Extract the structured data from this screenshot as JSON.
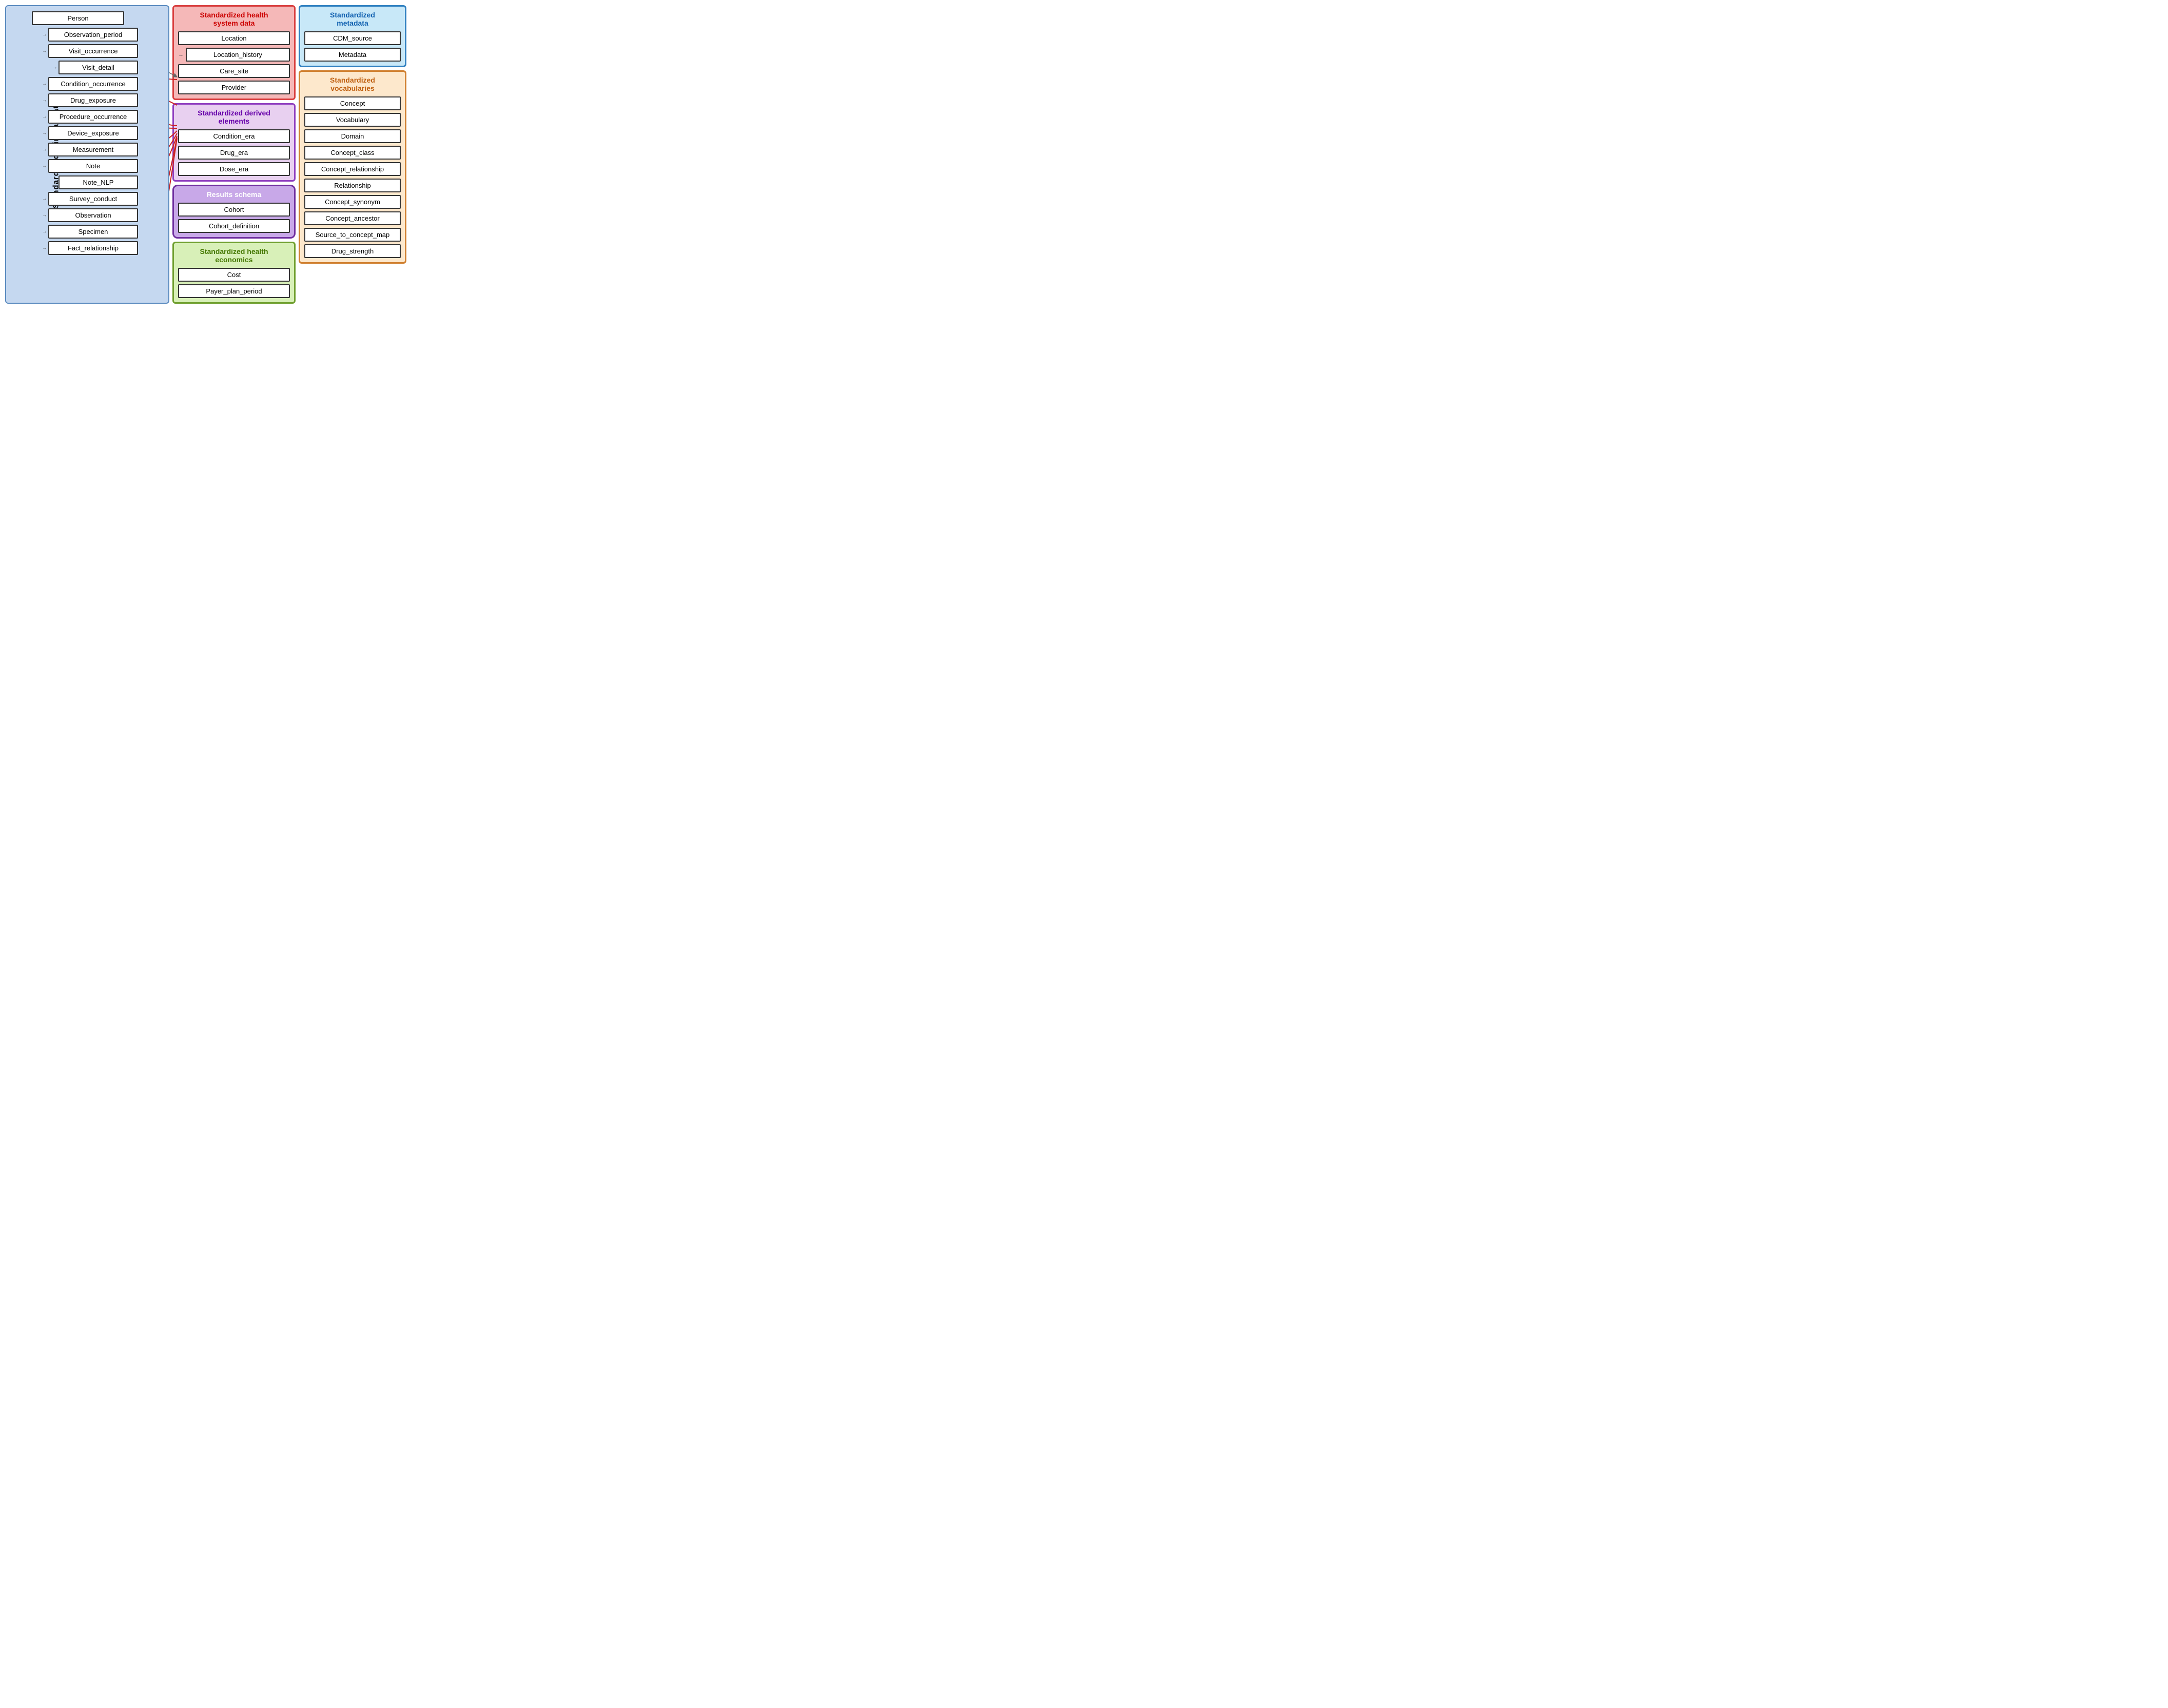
{
  "diagram": {
    "clinical": {
      "label": "Standardized clinical data",
      "boxes": [
        {
          "id": "person",
          "text": "Person",
          "indent": 0
        },
        {
          "id": "obs_period",
          "text": "Observation_period",
          "indent": 1
        },
        {
          "id": "visit_occ",
          "text": "Visit_occurrence",
          "indent": 1
        },
        {
          "id": "visit_detail",
          "text": "Visit_detail",
          "indent": 2
        },
        {
          "id": "condition_occ",
          "text": "Condition_occurrence",
          "indent": 1
        },
        {
          "id": "drug_exp",
          "text": "Drug_exposure",
          "indent": 1
        },
        {
          "id": "proc_occ",
          "text": "Procedure_occurrence",
          "indent": 1
        },
        {
          "id": "device_exp",
          "text": "Device_exposure",
          "indent": 1
        },
        {
          "id": "measurement",
          "text": "Measurement",
          "indent": 1
        },
        {
          "id": "note",
          "text": "Note",
          "indent": 1
        },
        {
          "id": "note_nlp",
          "text": "Note_NLP",
          "indent": 2
        },
        {
          "id": "survey",
          "text": "Survey_conduct",
          "indent": 1
        },
        {
          "id": "observation",
          "text": "Observation",
          "indent": 1
        },
        {
          "id": "specimen",
          "text": "Specimen",
          "indent": 1
        },
        {
          "id": "fact_rel",
          "text": "Fact_relationship",
          "indent": 1
        }
      ]
    },
    "healthSystem": {
      "title": "Standardized health\nsystem data",
      "boxes": [
        {
          "id": "location",
          "text": "Location"
        },
        {
          "id": "loc_history",
          "text": "Location_history"
        },
        {
          "id": "care_site",
          "text": "Care_site"
        },
        {
          "id": "provider",
          "text": "Provider"
        }
      ]
    },
    "derived": {
      "title": "Standardized derived\nelements",
      "boxes": [
        {
          "id": "cond_era",
          "text": "Condition_era"
        },
        {
          "id": "drug_era",
          "text": "Drug_era"
        },
        {
          "id": "dose_era",
          "text": "Dose_era"
        }
      ]
    },
    "results": {
      "title": "Results schema",
      "boxes": [
        {
          "id": "cohort",
          "text": "Cohort"
        },
        {
          "id": "cohort_def",
          "text": "Cohort_definition"
        }
      ]
    },
    "economics": {
      "title": "Standardized health\neconomics",
      "boxes": [
        {
          "id": "cost",
          "text": "Cost"
        },
        {
          "id": "payer",
          "text": "Payer_plan_period"
        }
      ]
    },
    "metadata": {
      "title": "Standardized\nmetadata",
      "boxes": [
        {
          "id": "cdm_source",
          "text": "CDM_source"
        },
        {
          "id": "metadata",
          "text": "Metadata"
        }
      ]
    },
    "vocab": {
      "title": "Standardized\nvocabularies",
      "boxes": [
        {
          "id": "concept",
          "text": "Concept"
        },
        {
          "id": "vocabulary",
          "text": "Vocabulary"
        },
        {
          "id": "domain",
          "text": "Domain"
        },
        {
          "id": "concept_class",
          "text": "Concept_class"
        },
        {
          "id": "concept_rel",
          "text": "Concept_relationship"
        },
        {
          "id": "relationship",
          "text": "Relationship"
        },
        {
          "id": "concept_syn",
          "text": "Concept_synonym"
        },
        {
          "id": "concept_anc",
          "text": "Concept_ancestor"
        },
        {
          "id": "source_concept",
          "text": "Source_to_concept_map"
        },
        {
          "id": "drug_strength",
          "text": "Drug_strength"
        }
      ]
    }
  }
}
